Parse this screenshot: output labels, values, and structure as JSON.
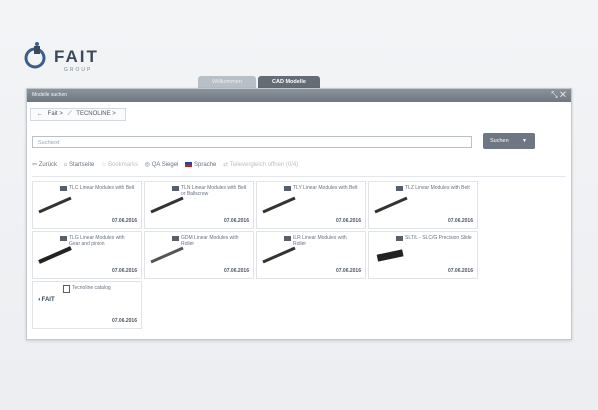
{
  "logo": {
    "text": "FAIT",
    "subtext": "GROUP"
  },
  "top_tabs": [
    {
      "label": "Willkommen",
      "active": false
    },
    {
      "label": "CAD Modelle",
      "active": true
    }
  ],
  "window": {
    "title": "Modelle suchen",
    "icons": [
      "resize-icon",
      "close-icon"
    ]
  },
  "breadcrumb": {
    "items": [
      "Fait >",
      "TECNOLINE >"
    ]
  },
  "search": {
    "placeholder": "Suchtext",
    "button_label": "Suchen"
  },
  "toolbar": {
    "back": "Zurück",
    "home": "Startseite",
    "favorites": "Bookmarks",
    "qa": "QA Siegel",
    "language": "Sprache",
    "compare": "Teilevergleich offnen (0/4)"
  },
  "items": [
    {
      "title": "TLC Linear Modules with Belt",
      "date": "07.06.2016"
    },
    {
      "title": "TLN Linear Modules with Belt or Ballscrew",
      "date": "07.06.2016"
    },
    {
      "title": "TLY Linear Modules with Belt",
      "date": "07.06.2016"
    },
    {
      "title": "TLZ Linear Modules with Belt",
      "date": "07.06.2016"
    },
    {
      "title": "TLG Linear Modules with Gear and pinion",
      "date": "07.06.2016"
    },
    {
      "title": "GDM Linear Modules with Roller",
      "date": "07.06.2016"
    },
    {
      "title": "ILR Linear Modules with Roller",
      "date": "07.06.2016"
    },
    {
      "title": "SLT/L - SLC/G Precision Slide",
      "date": "07.06.2016"
    },
    {
      "title": "Tecnoline catalog",
      "date": "07.06.2016"
    }
  ]
}
